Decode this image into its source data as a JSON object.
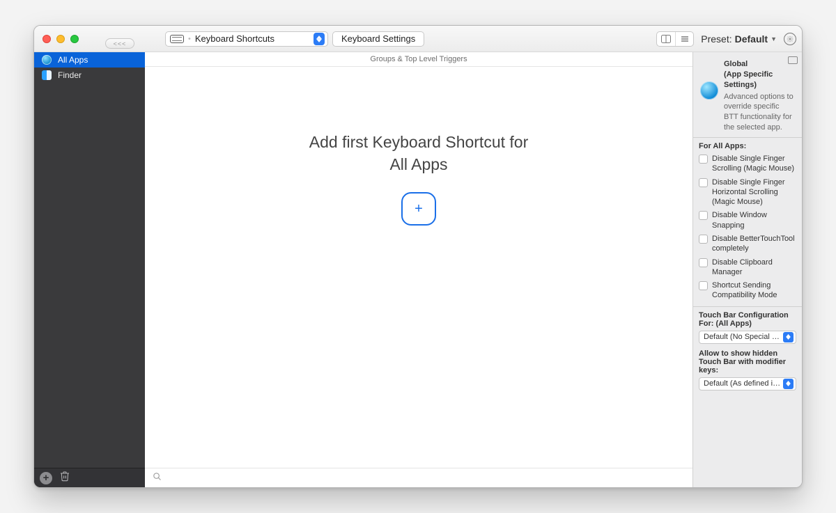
{
  "toolbar": {
    "back_label": "<<<",
    "trigger_selector": "Keyboard Shortcuts",
    "settings_button": "Keyboard Settings",
    "preset_prefix": "Preset: ",
    "preset_name": "Default"
  },
  "sidebar": {
    "items": [
      {
        "label": "All Apps",
        "icon": "globe",
        "selected": true
      },
      {
        "label": "Finder",
        "icon": "finder",
        "selected": false
      }
    ]
  },
  "main": {
    "subheader": "Groups & Top Level Triggers",
    "placeholder_line1": "Add first Keyboard Shortcut for",
    "placeholder_line2": "All Apps",
    "add_glyph": "+"
  },
  "inspector": {
    "global_title": "Global\n(App Specific Settings)",
    "global_desc": "Advanced options to override specific BTT functionality for the selected app.",
    "for_all_apps_title": "For All Apps:",
    "checkboxes": [
      "Disable Single Finger Scrolling (Magic Mouse)",
      "Disable Single Finger Horizontal Scrolling (Magic Mouse)",
      "Disable Window Snapping",
      "Disable BetterTouchTool completely",
      "Disable Clipboard Manager",
      "Shortcut Sending Compatibility Mode"
    ],
    "touchbar_title": "Touch Bar Configuration For: (All Apps)",
    "touchbar_popup": "Default (No Special Handli…",
    "modifier_title": "Allow to show hidden Touch Bar with modifier keys:",
    "modifier_popup": "Default (As defined in setti…"
  }
}
